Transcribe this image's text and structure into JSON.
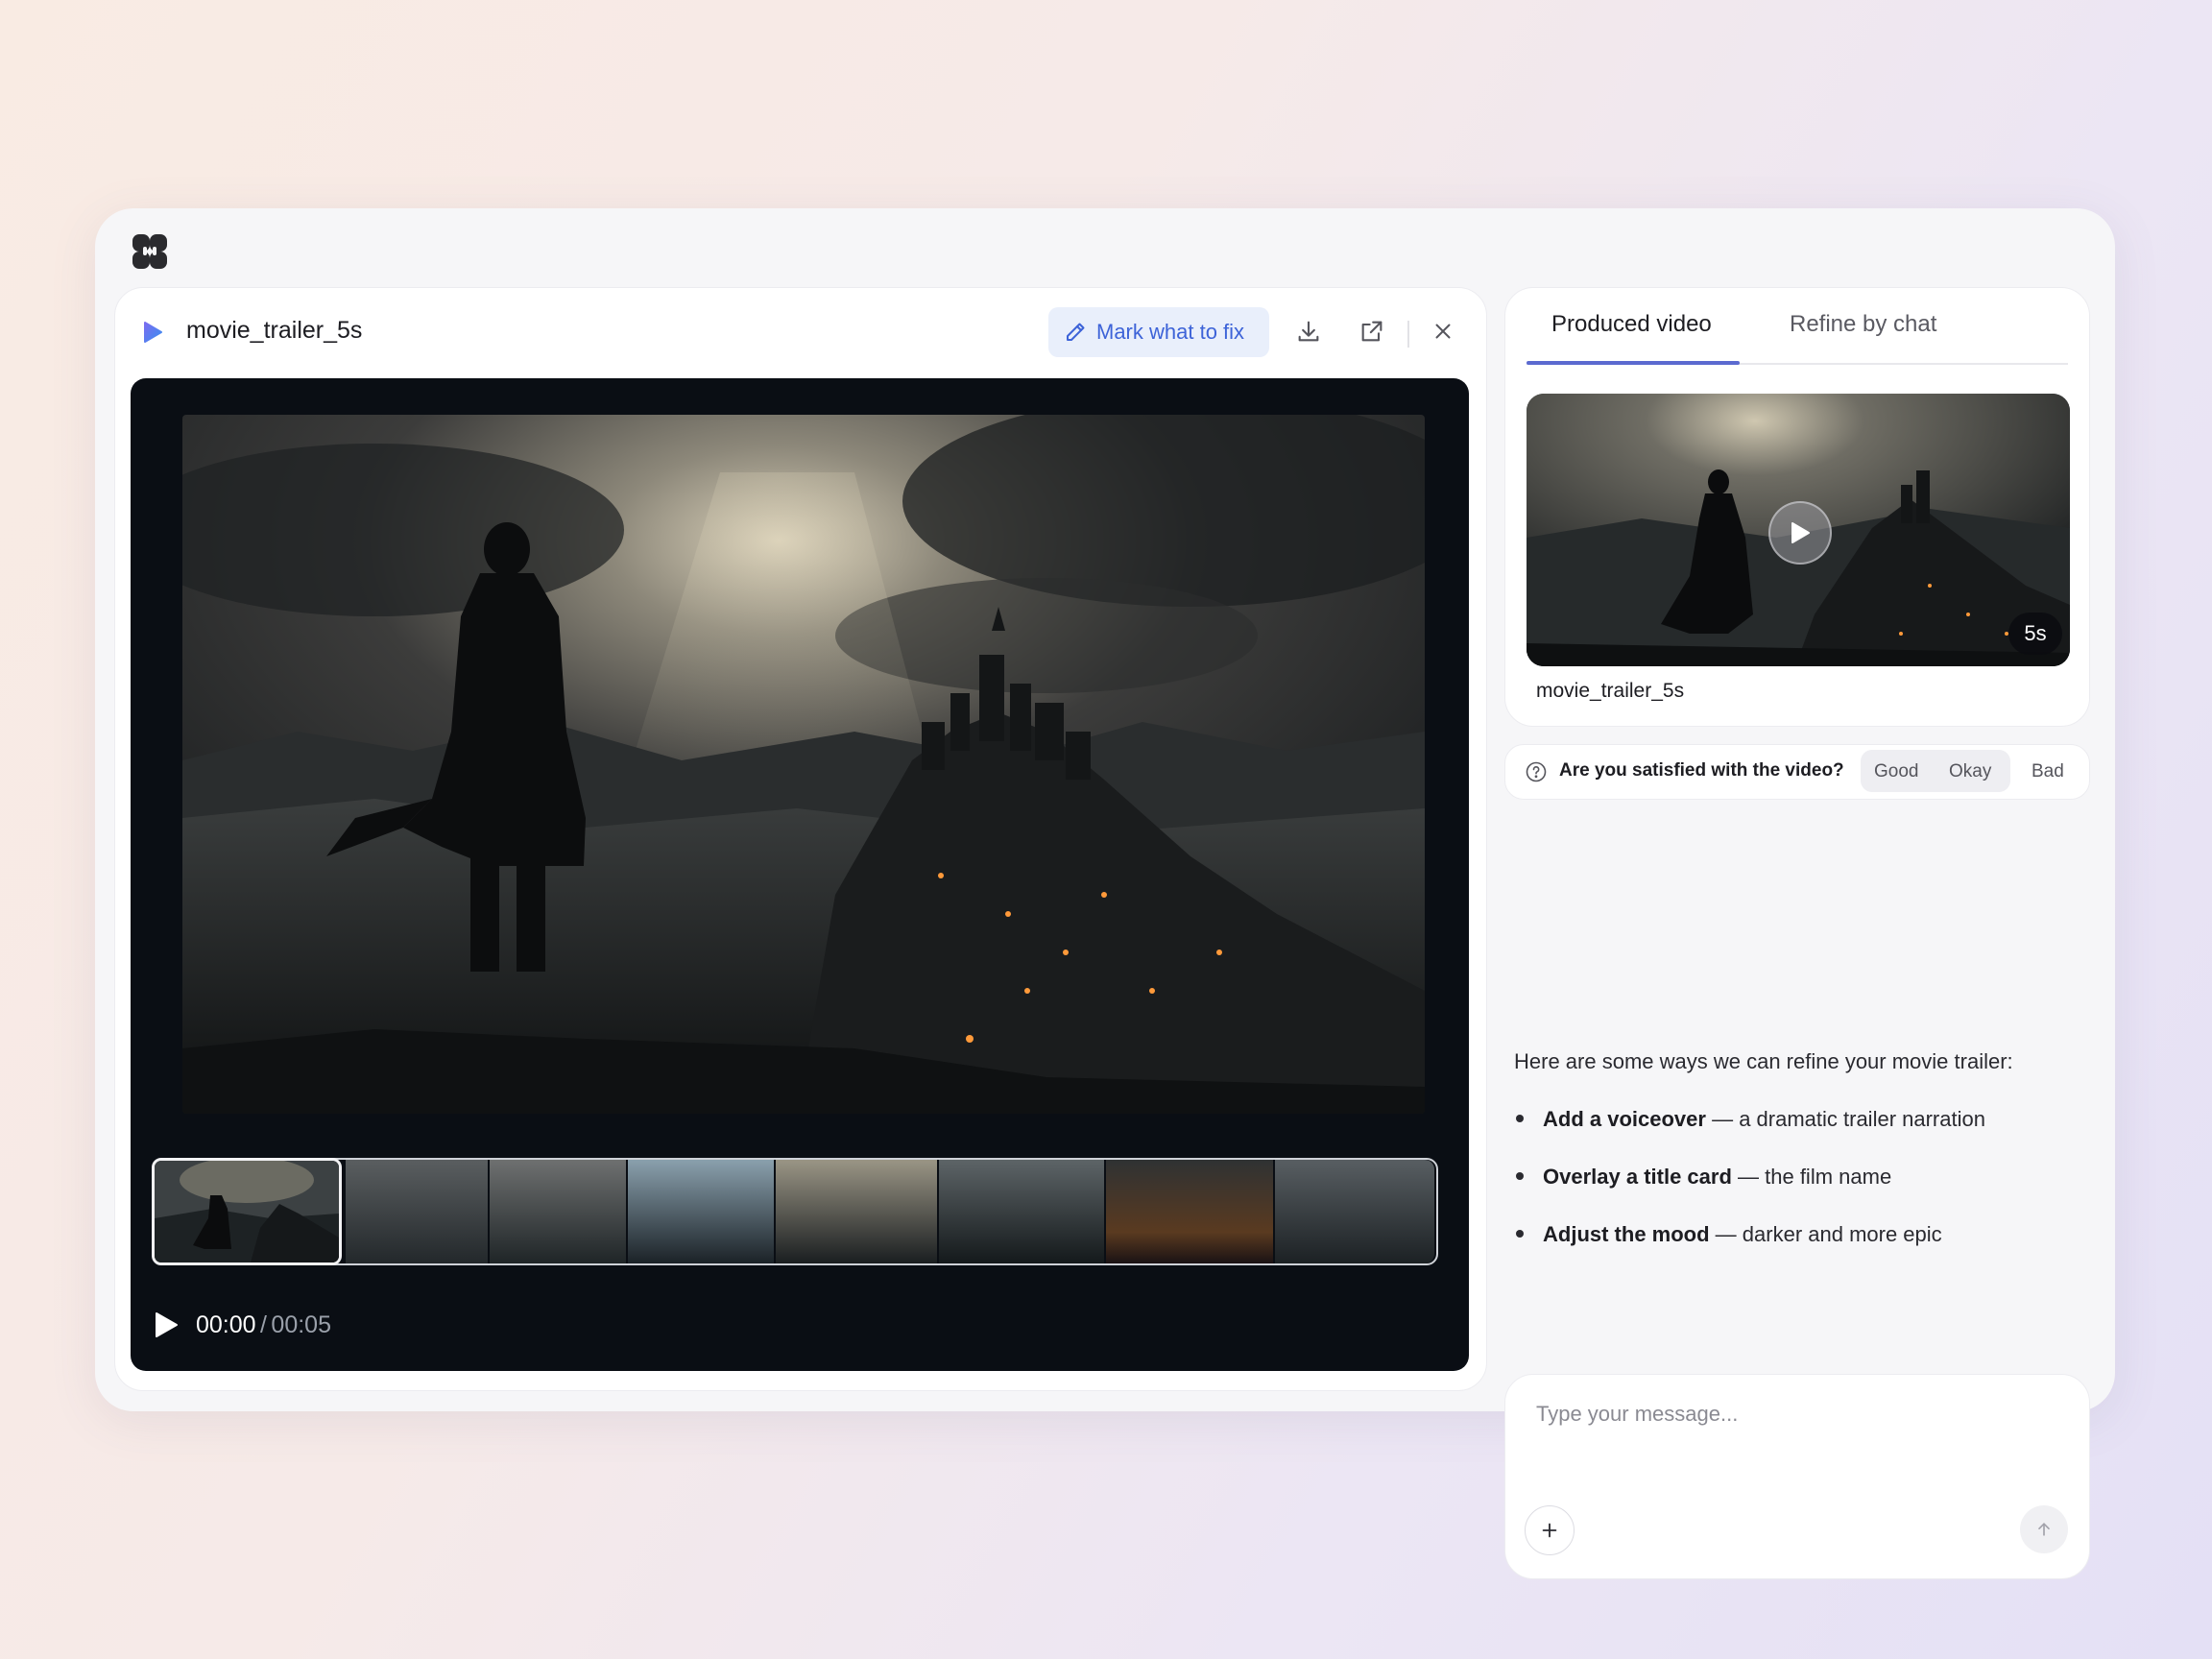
{
  "app": {
    "logo_icon": "app-logo-icon"
  },
  "viewer": {
    "file_name": "movie_trailer_5s",
    "mark_label": "Mark what to fix",
    "icons": [
      "video-file-icon",
      "pencil-icon",
      "download-icon",
      "open-external-icon",
      "close-icon"
    ],
    "time_current": "00:00",
    "time_separator": "/",
    "time_total": "00:05",
    "frames_count": 8
  },
  "tabs": {
    "produced": "Produced video",
    "refine": "Refine by chat",
    "active": "produced"
  },
  "produced": {
    "title": "movie_trailer_5s",
    "duration": "5s"
  },
  "feedback": {
    "question": "Are you satisfied with the video?",
    "options": [
      "Good",
      "Okay",
      "Bad"
    ]
  },
  "chat": {
    "intro": "Here are some ways we can refine your movie trailer:",
    "items": [
      {
        "title": "Add a voiceover",
        "desc": "— a dramatic trailer narration"
      },
      {
        "title": "Overlay a title card",
        "desc": "— the film name"
      },
      {
        "title": "Adjust the mood",
        "desc": "— darker and more epic"
      }
    ]
  },
  "composer": {
    "placeholder": "Type your message..."
  },
  "colors": {
    "accent": "#5b6ad0",
    "mark_bg": "#e9effb",
    "mark_text": "#3d63d8",
    "player_bg": "#0a0e14"
  }
}
